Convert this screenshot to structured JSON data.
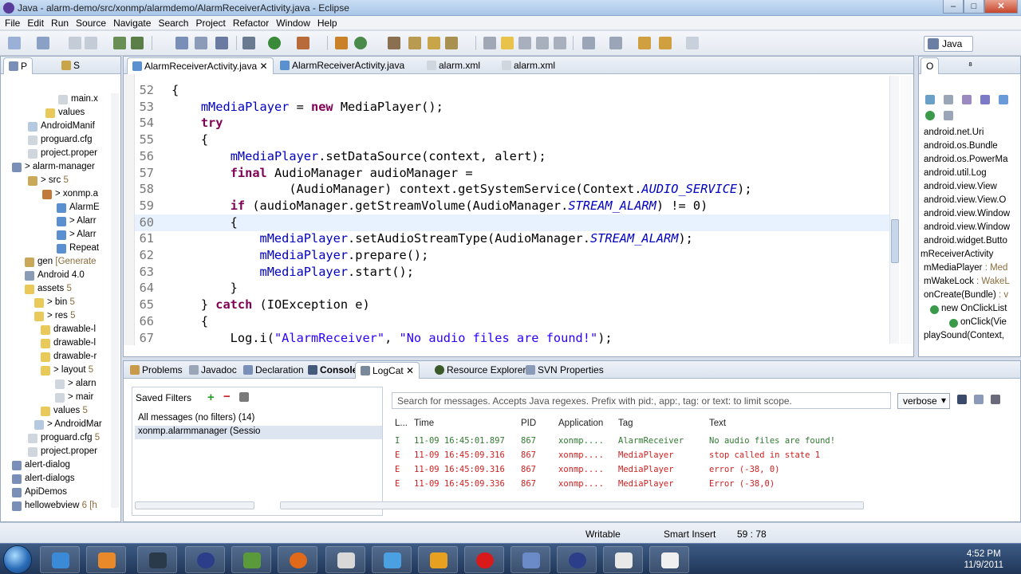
{
  "window": {
    "title": "Java - alarm-demo/src/xonmp/alarmdemo/AlarmReceiverActivity.java - Eclipse",
    "minimize": "–",
    "maximize": "□",
    "close": "✕"
  },
  "menu": [
    "File",
    "Edit",
    "Run",
    "Source",
    "Navigate",
    "Search",
    "Project",
    "Refactor",
    "Window",
    "Help"
  ],
  "perspective": "Java",
  "left_panel": {
    "tabs": [
      "P",
      "S"
    ],
    "tree": [
      {
        "label": "main.x",
        "sub": "",
        "indent": 88,
        "icon": "#d0d6de"
      },
      {
        "label": "values",
        "sub": "",
        "indent": 72,
        "icon": "#e8c95a"
      },
      {
        "label": "AndroidManif",
        "sub": "",
        "indent": 50,
        "icon": "#b5c9e0"
      },
      {
        "label": "proguard.cfg",
        "sub": "",
        "indent": 50,
        "icon": "#d0d6de"
      },
      {
        "label": "project.proper",
        "sub": "",
        "indent": 50,
        "icon": "#d0d6de"
      },
      {
        "label": "> alarm-manager",
        "sub": "",
        "indent": 30,
        "icon": "#7a8fb8"
      },
      {
        "label": "> src",
        "sub": " 5",
        "indent": 50,
        "icon": "#c9a85a"
      },
      {
        "label": "> xonmp.a",
        "sub": "",
        "indent": 68,
        "icon": "#c07a3a"
      },
      {
        "label": "AlarmE",
        "sub": "",
        "indent": 86,
        "icon": "#5a8fd0"
      },
      {
        "label": "> Alarr",
        "sub": "",
        "indent": 86,
        "icon": "#5a8fd0"
      },
      {
        "label": "> Alarr",
        "sub": "",
        "indent": 86,
        "icon": "#5a8fd0"
      },
      {
        "label": "Repeat",
        "sub": "",
        "indent": 86,
        "icon": "#5a8fd0"
      },
      {
        "label": "gen",
        "sub": " [Generate",
        "indent": 46,
        "icon": "#c9a85a"
      },
      {
        "label": "Android 4.0",
        "sub": "",
        "indent": 46,
        "icon": "#8a9bb5"
      },
      {
        "label": "assets",
        "sub": " 5",
        "indent": 46,
        "icon": "#e8c95a"
      },
      {
        "label": "> bin",
        "sub": " 5",
        "indent": 58,
        "icon": "#e8c95a"
      },
      {
        "label": "> res",
        "sub": " 5",
        "indent": 58,
        "icon": "#e8c95a"
      },
      {
        "label": "drawable-l",
        "sub": "",
        "indent": 66,
        "icon": "#e8c95a"
      },
      {
        "label": "drawable-l",
        "sub": "",
        "indent": 66,
        "icon": "#e8c95a"
      },
      {
        "label": "drawable-r",
        "sub": "",
        "indent": 66,
        "icon": "#e8c95a"
      },
      {
        "label": "> layout",
        "sub": " 5",
        "indent": 66,
        "icon": "#e8c95a"
      },
      {
        "label": "> alarn",
        "sub": "",
        "indent": 84,
        "icon": "#d0d6de"
      },
      {
        "label": "> mair",
        "sub": "",
        "indent": 84,
        "icon": "#d0d6de"
      },
      {
        "label": "values",
        "sub": " 5",
        "indent": 66,
        "icon": "#e8c95a"
      },
      {
        "label": "> AndroidMar",
        "sub": "",
        "indent": 58,
        "icon": "#b5c9e0"
      },
      {
        "label": "proguard.cfg",
        "sub": " 5",
        "indent": 50,
        "icon": "#d0d6de"
      },
      {
        "label": "project.proper",
        "sub": "",
        "indent": 50,
        "icon": "#d0d6de"
      },
      {
        "label": "alert-dialog",
        "sub": "",
        "indent": 30,
        "icon": "#7a8fb8"
      },
      {
        "label": "alert-dialogs",
        "sub": "",
        "indent": 30,
        "icon": "#7a8fb8"
      },
      {
        "label": "ApiDemos",
        "sub": "",
        "indent": 30,
        "icon": "#7a8fb8"
      },
      {
        "label": "hellowebview",
        "sub": " 6 [h",
        "indent": 30,
        "icon": "#7a8fb8"
      }
    ]
  },
  "editor": {
    "tabs": [
      {
        "label": "AlarmReceiverActivity.java",
        "close": "✕"
      },
      {
        "label": "AlarmReceiverActivity.java",
        "close": ""
      },
      {
        "label": "alarm.xml",
        "close": ""
      },
      {
        "label": "alarm.xml",
        "close": ""
      }
    ],
    "lines": [
      {
        "n": "52",
        "parts": [
          [
            "",
            "{"
          ]
        ]
      },
      {
        "n": "53",
        "parts": [
          [
            "",
            "    "
          ],
          [
            "fld",
            "mMediaPlayer"
          ],
          [
            "",
            " = "
          ],
          [
            "kw",
            "new"
          ],
          [
            "",
            " MediaPlayer();"
          ]
        ]
      },
      {
        "n": "54",
        "parts": [
          [
            "",
            "    "
          ],
          [
            "kw",
            "try"
          ]
        ]
      },
      {
        "n": "55",
        "parts": [
          [
            "",
            "    {"
          ]
        ]
      },
      {
        "n": "56",
        "parts": [
          [
            "",
            "        "
          ],
          [
            "fld",
            "mMediaPlayer"
          ],
          [
            "",
            ".setDataSource(context, alert);"
          ]
        ]
      },
      {
        "n": "57",
        "parts": [
          [
            "",
            "        "
          ],
          [
            "kw",
            "final"
          ],
          [
            "",
            " AudioManager audioManager ="
          ]
        ]
      },
      {
        "n": "58",
        "parts": [
          [
            "",
            "                (AudioManager) context.getSystemService(Context."
          ],
          [
            "sfld",
            "AUDIO_SERVICE"
          ],
          [
            "",
            ");"
          ]
        ]
      },
      {
        "n": "59",
        "parts": [
          [
            "",
            "        "
          ],
          [
            "kw",
            "if"
          ],
          [
            "",
            " (audioManager.getStreamVolume(AudioManager."
          ],
          [
            "sfld",
            "STREAM_ALARM"
          ],
          [
            "",
            ") != 0)"
          ]
        ]
      },
      {
        "n": "60",
        "parts": [
          [
            "",
            "        {"
          ]
        ]
      },
      {
        "n": "61",
        "parts": [
          [
            "",
            "            "
          ],
          [
            "fld",
            "mMediaPlayer"
          ],
          [
            "",
            ".setAudioStreamType(AudioManager."
          ],
          [
            "sfld",
            "STREAM_ALARM"
          ],
          [
            "",
            ");"
          ]
        ]
      },
      {
        "n": "62",
        "parts": [
          [
            "",
            "            "
          ],
          [
            "fld",
            "mMediaPlayer"
          ],
          [
            "",
            ".prepare();"
          ]
        ]
      },
      {
        "n": "63",
        "parts": [
          [
            "",
            "            "
          ],
          [
            "fld",
            "mMediaPlayer"
          ],
          [
            "",
            ".start();"
          ]
        ]
      },
      {
        "n": "64",
        "parts": [
          [
            "",
            "        }"
          ]
        ]
      },
      {
        "n": "65",
        "parts": [
          [
            "",
            "    } "
          ],
          [
            "kw",
            "catch"
          ],
          [
            "",
            " (IOException e)"
          ]
        ]
      },
      {
        "n": "66",
        "parts": [
          [
            "",
            "    {"
          ]
        ]
      },
      {
        "n": "67",
        "parts": [
          [
            "",
            "        Log.i("
          ],
          [
            "str",
            "\"AlarmReceiver\""
          ],
          [
            "",
            ", "
          ],
          [
            "str",
            "\"No audio files are found!\""
          ],
          [
            "",
            ");"
          ]
        ]
      }
    ],
    "current_line_index": 8
  },
  "outline": {
    "tabs": [
      "O",
      "⁸"
    ],
    "items": [
      {
        "label": "android.net.Uri",
        "indent": 6,
        "icon": ""
      },
      {
        "label": "android.os.Bundle",
        "indent": 6,
        "icon": ""
      },
      {
        "label": "android.os.PowerMa",
        "indent": 6,
        "icon": ""
      },
      {
        "label": "android.util.Log",
        "indent": 6,
        "icon": ""
      },
      {
        "label": "android.view.View",
        "indent": 6,
        "icon": ""
      },
      {
        "label": "android.view.View.O",
        "indent": 6,
        "icon": ""
      },
      {
        "label": "android.view.Window",
        "indent": 6,
        "icon": ""
      },
      {
        "label": "android.view.Window",
        "indent": 6,
        "icon": ""
      },
      {
        "label": "android.widget.Butto",
        "indent": 6,
        "icon": ""
      },
      {
        "label": "mReceiverActivity",
        "indent": 2,
        "icon": ""
      },
      {
        "label": "mMediaPlayer",
        "indent": 6,
        "icon": "",
        "suffix": " : Med"
      },
      {
        "label": "mWakeLock",
        "indent": 6,
        "icon": "",
        "suffix": " : WakeL"
      },
      {
        "label": "onCreate(Bundle)",
        "indent": 6,
        "icon": "",
        "suffix": " : v"
      },
      {
        "label": "new OnClickList",
        "indent": 28,
        "icon": "#3a9a4a"
      },
      {
        "label": "onClick(Vie",
        "indent": 52,
        "icon": "#3a9a4a"
      },
      {
        "label": "playSound(Context,",
        "indent": 6,
        "icon": ""
      }
    ]
  },
  "bottom": {
    "tabs": [
      "Problems",
      "Javadoc",
      "Declaration",
      "Console",
      "LogCat",
      "Resource Explorer",
      "SVN Properties"
    ],
    "saved_filters": {
      "title": "Saved Filters",
      "items": [
        "All messages (no filters) (14)",
        "xonmp.alarmmanager (Sessio"
      ]
    },
    "search_placeholder": "Search for messages. Accepts Java regexes. Prefix with pid:, app:, tag: or text: to limit scope.",
    "level": "verbose",
    "columns": [
      "L...",
      "Time",
      "PID",
      "Application",
      "Tag",
      "Text"
    ],
    "rows": [
      {
        "level": "I",
        "time": "11-09 16:45:01.897",
        "pid": "867",
        "app": "xonmp....",
        "tag": "AlarmReceiver",
        "text": "No audio files are found!"
      },
      {
        "level": "E",
        "time": "11-09 16:45:09.316",
        "pid": "867",
        "app": "xonmp....",
        "tag": "MediaPlayer",
        "text": "stop called in state 1"
      },
      {
        "level": "E",
        "time": "11-09 16:45:09.316",
        "pid": "867",
        "app": "xonmp....",
        "tag": "MediaPlayer",
        "text": "error (-38, 0)"
      },
      {
        "level": "E",
        "time": "11-09 16:45:09.336",
        "pid": "867",
        "app": "xonmp....",
        "tag": "MediaPlayer",
        "text": "Error (-38,0)"
      }
    ]
  },
  "statusbar": {
    "mode": "Writable",
    "insert": "Smart Insert",
    "position": "59 : 78"
  },
  "taskbar": {
    "time": "4:52 PM",
    "date": "11/9/2011"
  },
  "colors": {
    "accent": "#7f0055",
    "field": "#0000c0",
    "string": "#2a00ff",
    "error": "#d02020",
    "info": "#307a30"
  },
  "icons": [
    "window-app-icon",
    "java-perspective-icon",
    "windows-start-icon",
    "firefox-icon",
    "opera-icon",
    "eclipse-icon"
  ]
}
